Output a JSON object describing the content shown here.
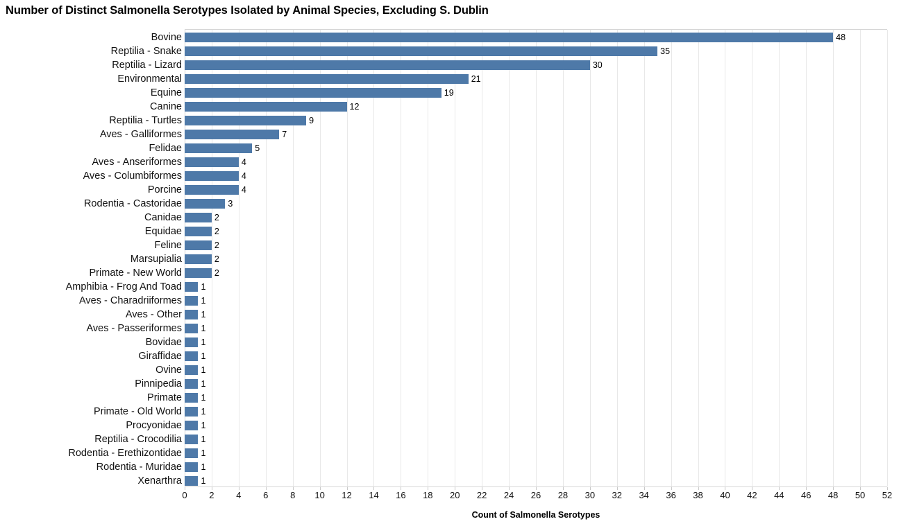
{
  "chart_data": {
    "type": "bar",
    "orientation": "horizontal",
    "title": "Number of Distinct Salmonella Serotypes Isolated by Animal Species, Excluding S. Dublin",
    "xlabel": "Count of Salmonella Serotypes",
    "ylabel": "",
    "xlim": [
      0,
      52
    ],
    "xticks": [
      0,
      2,
      4,
      6,
      8,
      10,
      12,
      14,
      16,
      18,
      20,
      22,
      24,
      26,
      28,
      30,
      32,
      34,
      36,
      38,
      40,
      42,
      44,
      46,
      48,
      50,
      52
    ],
    "grid": true,
    "legend": false,
    "bar_color": "#4E79A8",
    "value_labels": true,
    "categories": [
      "Bovine",
      "Reptilia - Snake",
      "Reptilia - Lizard",
      "Environmental",
      "Equine",
      "Canine",
      "Reptilia - Turtles",
      "Aves - Galliformes",
      "Felidae",
      "Aves - Anseriformes",
      "Aves - Columbiformes",
      "Porcine",
      "Rodentia - Castoridae",
      "Canidae",
      "Equidae",
      "Feline",
      "Marsupialia",
      "Primate - New World",
      "Amphibia - Frog And Toad",
      "Aves - Charadriiformes",
      "Aves - Other",
      "Aves - Passeriformes",
      "Bovidae",
      "Giraffidae",
      "Ovine",
      "Pinnipedia",
      "Primate",
      "Primate - Old World",
      "Procyonidae",
      "Reptilia - Crocodilia",
      "Rodentia - Erethizontidae",
      "Rodentia - Muridae",
      "Xenarthra"
    ],
    "values": [
      48,
      35,
      30,
      21,
      19,
      12,
      9,
      7,
      5,
      4,
      4,
      4,
      3,
      2,
      2,
      2,
      2,
      2,
      1,
      1,
      1,
      1,
      1,
      1,
      1,
      1,
      1,
      1,
      1,
      1,
      1,
      1,
      1
    ]
  }
}
